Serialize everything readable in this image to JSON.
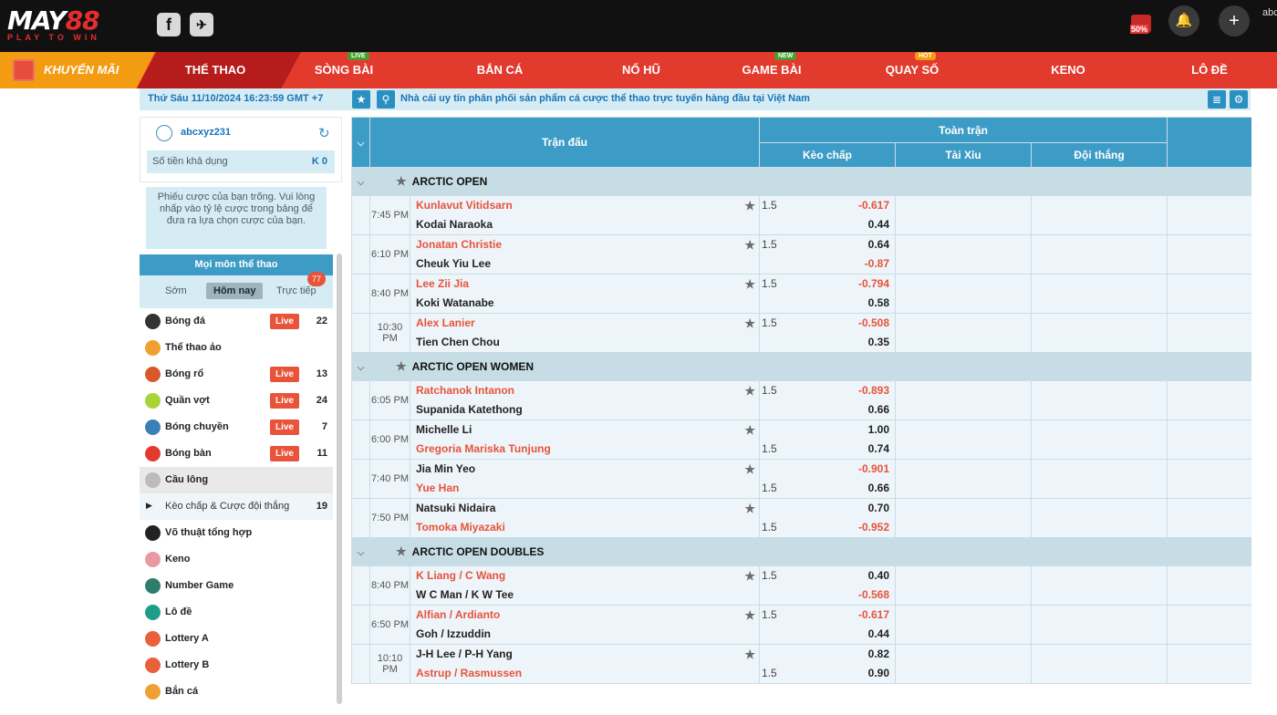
{
  "header": {
    "logo_main": "MAY",
    "logo_num": "88",
    "logo_sub": "PLAY TO WIN",
    "facebook": "f",
    "telegram": "✈",
    "gift_badge": "50%",
    "bell": "🔔",
    "plus": "+",
    "user_short": "abc"
  },
  "nav": {
    "promo": "KHUYẾN MÃI",
    "items": [
      {
        "label": "THỂ THAO",
        "badge": ""
      },
      {
        "label": "SÒNG BÀI",
        "badge": "LIVE"
      },
      {
        "label": "BẮN CÁ",
        "badge": ""
      },
      {
        "label": "NỔ HŨ",
        "badge": ""
      },
      {
        "label": "GAME BÀI",
        "badge": "NEW"
      },
      {
        "label": "QUAY SỐ",
        "badge": "HOT"
      },
      {
        "label": "KENO",
        "badge": ""
      },
      {
        "label": "LÔ ĐỀ",
        "badge": ""
      }
    ]
  },
  "infobar": {
    "datetime": "Thứ Sáu 11/10/2024 16:23:59 GMT +7",
    "message": "Nhà cái uy tín phân phối sản phẩm cá cược thể thao trực tuyến hàng đầu tại Việt Nam"
  },
  "account": {
    "username": "abcxyz231",
    "balance_label": "Số tiền khả dụng",
    "balance_value": "K 0"
  },
  "betslip": {
    "empty_msg": "Phiếu cược của bạn trống. Vui lòng nhấp vào tỷ lệ cược trong bảng để đưa ra lựa chọn cược của bạn."
  },
  "sports": {
    "title": "Mọi môn thể thao",
    "tabs": [
      "Sớm",
      "Hôm nay",
      "Trực tiếp"
    ],
    "live_count": "77",
    "live_label": "Live",
    "list": [
      {
        "name": "Bóng đá",
        "live": true,
        "count": "22",
        "color": "#333333"
      },
      {
        "name": "Thể thao ảo",
        "live": false,
        "count": "",
        "color": "#f0a030"
      },
      {
        "name": "Bóng rổ",
        "live": true,
        "count": "13",
        "color": "#d9582b"
      },
      {
        "name": "Quần vợt",
        "live": true,
        "count": "24",
        "color": "#a8d43a"
      },
      {
        "name": "Bóng chuyền",
        "live": true,
        "count": "7",
        "color": "#3b7fb8"
      },
      {
        "name": "Bóng bàn",
        "live": true,
        "count": "11",
        "color": "#e23b2e"
      },
      {
        "name": "Cầu lông",
        "live": false,
        "count": "",
        "color": "#bbbbbb"
      },
      {
        "name": "Kèo chấp & Cược đội thắng",
        "live": false,
        "count": "19",
        "color": ""
      },
      {
        "name": "Võ thuật tổng hợp",
        "live": false,
        "count": "",
        "color": "#222222"
      },
      {
        "name": "Keno",
        "live": false,
        "count": "",
        "color": "#e89aa0"
      },
      {
        "name": "Number Game",
        "live": false,
        "count": "",
        "color": "#2e7d6b"
      },
      {
        "name": "Lô đề",
        "live": false,
        "count": "",
        "color": "#1e9e8a"
      },
      {
        "name": "Lottery A",
        "live": false,
        "count": "",
        "color": "#e9613a"
      },
      {
        "name": "Lottery B",
        "live": false,
        "count": "",
        "color": "#e9613a"
      },
      {
        "name": "Bắn cá",
        "live": false,
        "count": "",
        "color": "#f0a030"
      }
    ]
  },
  "table": {
    "col_match": "Trận đấu",
    "col_group": "Toàn trận",
    "col_handicap": "Kèo chấp",
    "col_ou": "Tài Xỉu",
    "col_winner": "Đội thắng",
    "leagues": [
      {
        "name": "ARCTIC OPEN",
        "matches": [
          {
            "time": "7:45 PM",
            "home": "Kunlavut Vitidsarn",
            "away": "Kodai Naraoka",
            "fav": "home",
            "line": "1.5",
            "home_odds": "-0.617",
            "away_odds": "0.44"
          },
          {
            "time": "6:10 PM",
            "home": "Jonatan Christie",
            "away": "Cheuk Yiu Lee",
            "fav": "home",
            "line": "1.5",
            "home_odds": "0.64",
            "away_odds": "-0.87"
          },
          {
            "time": "8:40 PM",
            "home": "Lee Zii Jia",
            "away": "Koki Watanabe",
            "fav": "home",
            "line": "1.5",
            "home_odds": "-0.794",
            "away_odds": "0.58"
          },
          {
            "time": "10:30 PM",
            "home": "Alex Lanier",
            "away": "Tien Chen Chou",
            "fav": "home",
            "line": "1.5",
            "home_odds": "-0.508",
            "away_odds": "0.35"
          }
        ]
      },
      {
        "name": "ARCTIC OPEN WOMEN",
        "matches": [
          {
            "time": "6:05 PM",
            "home": "Ratchanok Intanon",
            "away": "Supanida Katethong",
            "fav": "home",
            "line": "1.5",
            "home_odds": "-0.893",
            "away_odds": "0.66"
          },
          {
            "time": "6:00 PM",
            "home": "Michelle Li",
            "away": "Gregoria Mariska Tunjung",
            "fav": "away",
            "line": "1.5",
            "home_odds": "1.00",
            "away_odds": "0.74"
          },
          {
            "time": "7:40 PM",
            "home": "Jia Min Yeo",
            "away": "Yue Han",
            "fav": "away",
            "line": "1.5",
            "home_odds": "-0.901",
            "away_odds": "0.66"
          },
          {
            "time": "7:50 PM",
            "home": "Natsuki Nidaira",
            "away": "Tomoka Miyazaki",
            "fav": "away",
            "line": "1.5",
            "home_odds": "0.70",
            "away_odds": "-0.952"
          }
        ]
      },
      {
        "name": "ARCTIC OPEN DOUBLES",
        "matches": [
          {
            "time": "8:40 PM",
            "home": "K Liang / C Wang",
            "away": "W C Man / K W Tee",
            "fav": "home",
            "line": "1.5",
            "home_odds": "0.40",
            "away_odds": "-0.568"
          },
          {
            "time": "6:50 PM",
            "home": "Alfian / Ardianto",
            "away": "Goh / Izzuddin",
            "fav": "home",
            "line": "1.5",
            "home_odds": "-0.617",
            "away_odds": "0.44"
          },
          {
            "time": "10:10 PM",
            "home": "J-H Lee / P-H Yang",
            "away": "Astrup / Rasmussen",
            "fav": "away",
            "line": "1.5",
            "home_odds": "0.82",
            "away_odds": "0.90"
          }
        ]
      }
    ]
  }
}
